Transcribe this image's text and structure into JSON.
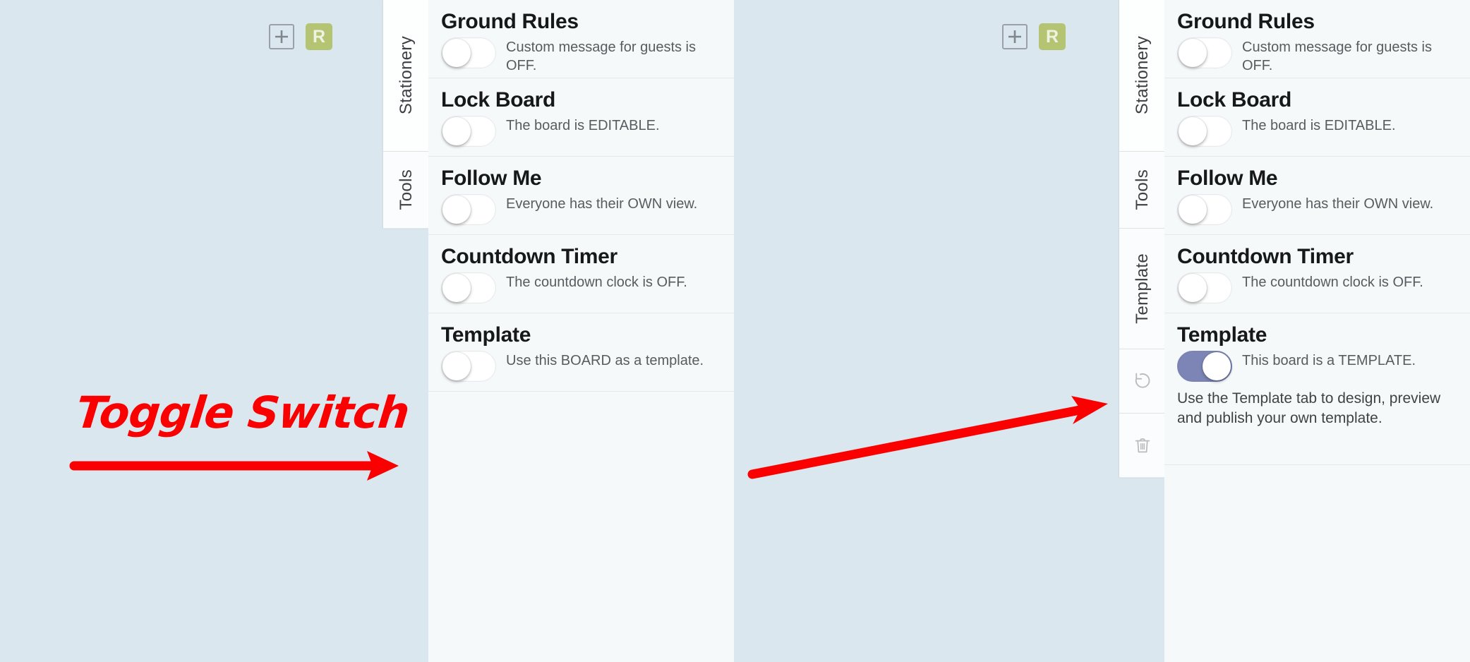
{
  "background_color": "#dae7ee",
  "annotation": {
    "label": "Toggle Switch",
    "color": "#fa0000"
  },
  "accent_colors": {
    "toggle_on": "#7c85b5",
    "avatar": "#b5c473"
  },
  "toolbar": {
    "add_label": "+",
    "avatar_initial": "R"
  },
  "panels": [
    {
      "id": "before",
      "tabs": [
        {
          "label": "Stationery",
          "selected": true,
          "type": "text"
        },
        {
          "label": "Tools",
          "selected": false,
          "type": "text"
        }
      ],
      "cards": [
        {
          "title": "Ground Rules",
          "desc": "Custom message for guests is OFF.",
          "toggle_on": false,
          "note": ""
        },
        {
          "title": "Lock Board",
          "desc": "The board is EDITABLE.",
          "toggle_on": false,
          "note": ""
        },
        {
          "title": "Follow Me",
          "desc": "Everyone has their OWN view.",
          "toggle_on": false,
          "note": ""
        },
        {
          "title": "Countdown Timer",
          "desc": "The countdown clock is OFF.",
          "toggle_on": false,
          "note": ""
        },
        {
          "title": "Template",
          "desc": "Use this BOARD as a template.",
          "toggle_on": false,
          "note": ""
        }
      ]
    },
    {
      "id": "after",
      "tabs": [
        {
          "label": "Stationery",
          "selected": true,
          "type": "text"
        },
        {
          "label": "Tools",
          "selected": false,
          "type": "text"
        },
        {
          "label": "Template",
          "selected": false,
          "type": "text"
        },
        {
          "label": "undo-icon",
          "selected": false,
          "type": "icon"
        },
        {
          "label": "trash-icon",
          "selected": false,
          "type": "icon"
        }
      ],
      "cards": [
        {
          "title": "Ground Rules",
          "desc": "Custom message for guests is OFF.",
          "toggle_on": false,
          "note": ""
        },
        {
          "title": "Lock Board",
          "desc": "The board is EDITABLE.",
          "toggle_on": false,
          "note": ""
        },
        {
          "title": "Follow Me",
          "desc": "Everyone has their OWN view.",
          "toggle_on": false,
          "note": ""
        },
        {
          "title": "Countdown Timer",
          "desc": "The countdown clock is OFF.",
          "toggle_on": false,
          "note": ""
        },
        {
          "title": "Template",
          "desc": "This board is a TEMPLATE.",
          "toggle_on": true,
          "note": "Use the Template tab to design, preview and publish your own template."
        }
      ]
    }
  ]
}
